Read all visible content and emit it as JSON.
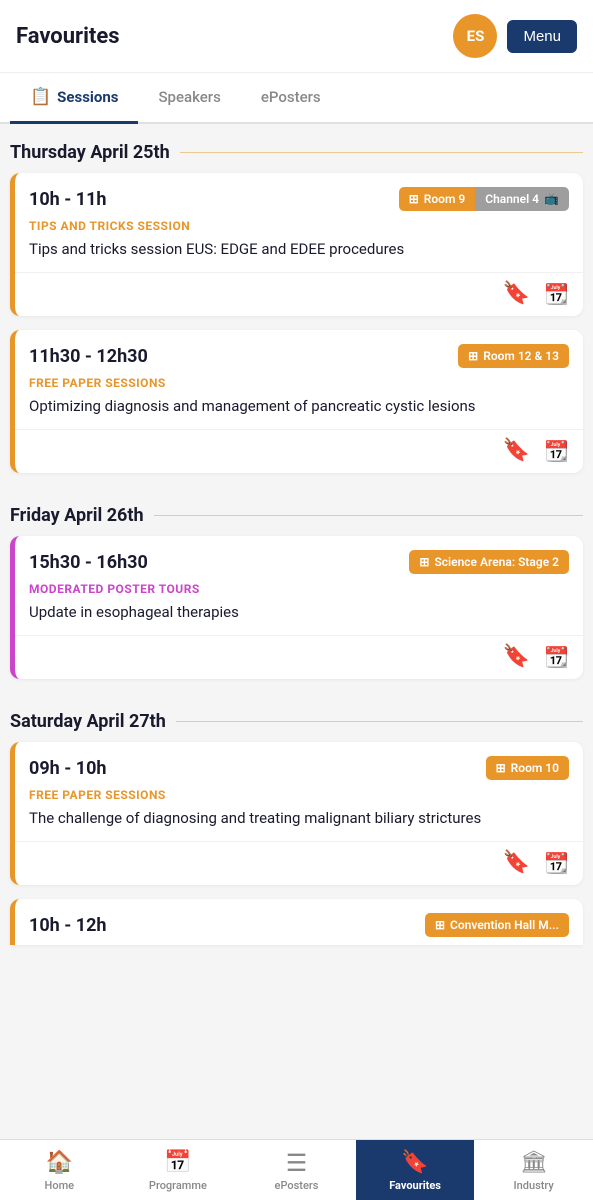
{
  "header": {
    "title": "Favourites",
    "avatar_initials": "ES",
    "menu_label": "Menu"
  },
  "tabs": [
    {
      "id": "sessions",
      "label": "Sessions",
      "active": true
    },
    {
      "id": "speakers",
      "label": "Speakers",
      "active": false
    },
    {
      "id": "eposters",
      "label": "ePosters",
      "active": false
    }
  ],
  "days": [
    {
      "id": "thursday",
      "label": "Thursday April 25th",
      "sessions": [
        {
          "id": "s1",
          "time": "10h - 11h",
          "room": "Room 9",
          "channel": "Channel 4",
          "has_channel": true,
          "border_color": "orange",
          "type_label": "TIPS AND TRICKS SESSION",
          "type_color": "orange",
          "title": "Tips and tricks session EUS: EDGE and EDEE procedures"
        },
        {
          "id": "s2",
          "time": "11h30 - 12h30",
          "room": "Room 12 & 13",
          "channel": null,
          "has_channel": false,
          "border_color": "orange",
          "type_label": "FREE PAPER SESSIONS",
          "type_color": "orange",
          "title": "Optimizing diagnosis and management of pancreatic cystic lesions"
        }
      ]
    },
    {
      "id": "friday",
      "label": "Friday April 26th",
      "sessions": [
        {
          "id": "s3",
          "time": "15h30 - 16h30",
          "room": "Science Arena: Stage 2",
          "channel": null,
          "has_channel": false,
          "border_color": "purple",
          "type_label": "MODERATED POSTER TOURS",
          "type_color": "purple",
          "title": "Update in esophageal therapies"
        }
      ]
    },
    {
      "id": "saturday",
      "label": "Saturday April 27th",
      "sessions": [
        {
          "id": "s4",
          "time": "09h - 10h",
          "room": "Room 10",
          "channel": null,
          "has_channel": false,
          "border_color": "orange",
          "type_label": "FREE PAPER SESSIONS",
          "type_color": "orange",
          "title": "The challenge of diagnosing and treating malignant biliary strictures"
        },
        {
          "id": "s5",
          "time": "10h - 12h",
          "room": "Convention Hall M...",
          "channel": null,
          "has_channel": false,
          "border_color": "orange",
          "type_label": "...",
          "type_color": "orange",
          "title": "",
          "partial": true
        }
      ]
    }
  ],
  "bottom_nav": [
    {
      "id": "home",
      "label": "Home",
      "icon": "house",
      "active": false
    },
    {
      "id": "programme",
      "label": "Programme",
      "icon": "calendar",
      "active": false
    },
    {
      "id": "eposters",
      "label": "ePosters",
      "icon": "eposters",
      "active": false
    },
    {
      "id": "favourites",
      "label": "Favourites",
      "icon": "bookmark",
      "active": true
    },
    {
      "id": "industry",
      "label": "Industry",
      "icon": "building",
      "active": false
    }
  ]
}
